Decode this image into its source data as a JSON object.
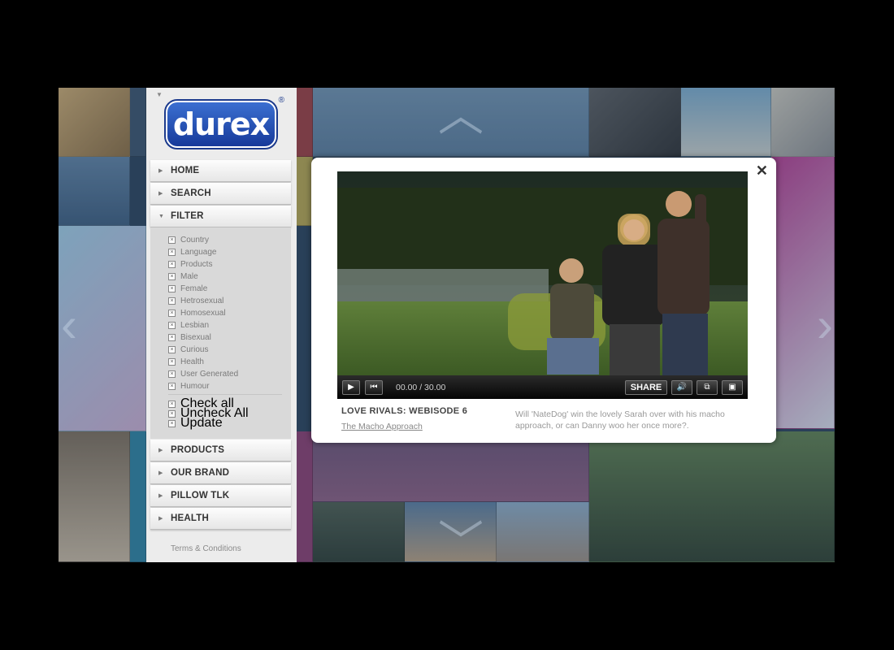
{
  "sidebar": {
    "logo_text": "durex",
    "logo_reg": "®",
    "nav": {
      "home": "HOME",
      "search": "SEARCH",
      "filter": "FILTER",
      "products": "PRODUCTS",
      "our_brand": "OUR BRAND",
      "pillow_tlk": "PILLOW TLK",
      "health": "HEALTH"
    },
    "filter_items": [
      "Country",
      "Language",
      "Products",
      "Male",
      "Female",
      "Hetrosexual",
      "Homosexual",
      "Lesbian",
      "Bisexual",
      "Curious",
      "Health",
      "User Generated",
      "Humour"
    ],
    "filter_actions": [
      "Check all",
      "Uncheck All",
      "Update"
    ],
    "check_glyph": "×",
    "terms": "Terms & Conditions"
  },
  "player": {
    "time": "00.00 / 30.00",
    "share_label": "SHARE",
    "close_glyph": "✕"
  },
  "episode": {
    "title": "LOVE RIVALS: WEBISODE 6",
    "subtitle": "The Macho Approach",
    "description": "Will 'NateDog' win the lovely Sarah over with his macho approach, or can Danny woo her once more?."
  },
  "colors": {
    "brand_blue": "#1c3a8c",
    "sidebar_bg": "#ececec",
    "overlay": "#2a3f55"
  }
}
